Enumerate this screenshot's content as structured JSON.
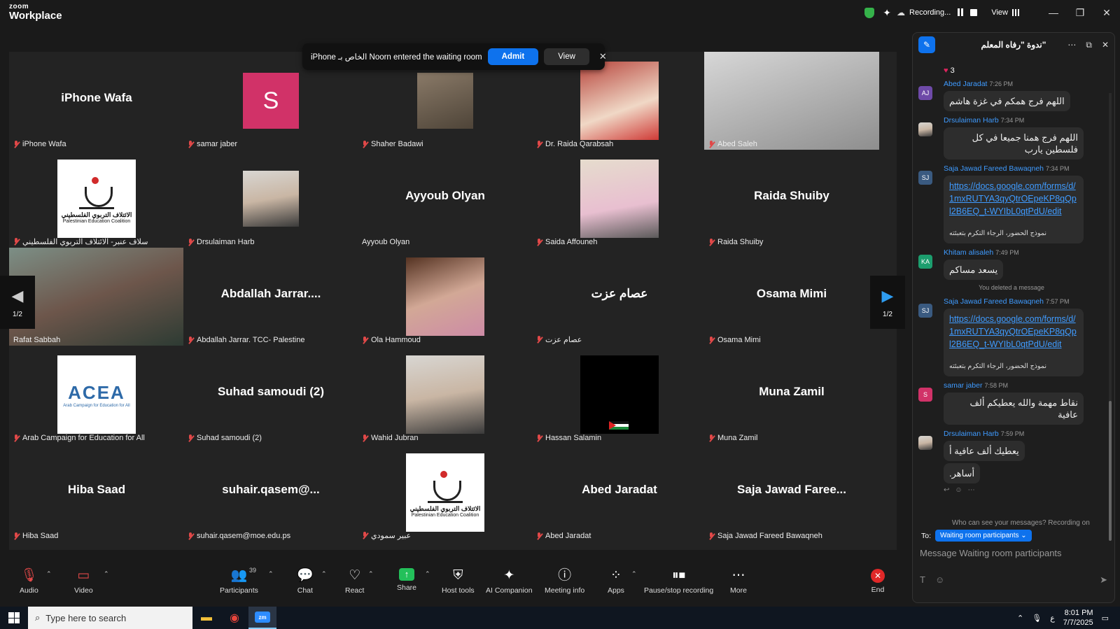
{
  "app": {
    "brand_top": "zoom",
    "brand_name": "Workplace",
    "recording_label": "Recording...",
    "view_label": "View"
  },
  "banner": {
    "text": "iPhone الخاص بـ Noorn entered the waiting room",
    "admit": "Admit",
    "view": "View"
  },
  "pager": {
    "left": "1/2",
    "right": "1/2"
  },
  "tiles": [
    {
      "big": "iPhone Wafa",
      "name": "iPhone Wafa"
    },
    {
      "avatar": "S",
      "name": "samar jaber"
    },
    {
      "name": "Shaher Badawi"
    },
    {
      "name": "Dr. Raida Qarabsah"
    },
    {
      "name": "Abed Saleh"
    },
    {
      "name": "سلاف عنبر- الائتلاف التربوي الفلسطيني",
      "logo_ar": "الائتلاف التربوي الفلسطيني",
      "logo_en": "Palestinian Education Coalition"
    },
    {
      "name": "Drsulaiman Harb"
    },
    {
      "big": "Ayyoub Olyan",
      "name": "Ayyoub Olyan"
    },
    {
      "name": "Saida Affouneh"
    },
    {
      "big": "Raida Shuiby",
      "name": "Raida Shuiby"
    },
    {
      "name": "Rafat Sabbah"
    },
    {
      "big": "Abdallah Jarrar....",
      "name": "Abdallah Jarrar. TCC- Palestine"
    },
    {
      "name": "Ola Hammoud"
    },
    {
      "big": "عصام عزت",
      "name": "عصام عزت"
    },
    {
      "big": "Osama Mimi",
      "name": "Osama Mimi"
    },
    {
      "name": "Arab Campaign for Education for All",
      "logo_big": "ACEA",
      "logo_sub": "Arab Campaign for Education for All"
    },
    {
      "big": "Suhad samoudi (2)",
      "name": "Suhad samoudi (2)"
    },
    {
      "name": "Wahid Jubran"
    },
    {
      "name": "Hassan Salamin"
    },
    {
      "big": "Muna Zamil",
      "name": "Muna Zamil"
    },
    {
      "big": "Hiba Saad",
      "name": "Hiba Saad"
    },
    {
      "big": "suhair.qasem@...",
      "name": "suhair.qasem@moe.edu.ps"
    },
    {
      "name": "عبير سمودي",
      "logo_ar": "الائتلاف التربوي الفلسطيني",
      "logo_en": "Palestinian Education Coalition"
    },
    {
      "big": "Abed Jaradat",
      "name": "Abed Jaradat"
    },
    {
      "big": "Saja Jawad Faree...",
      "name": "Saja Jawad Fareed Bawaqneh"
    }
  ],
  "chat": {
    "title": "ندوة \"رفاه المعلم\"",
    "reaction_count": "3",
    "messages": [
      {
        "avatar": "AJ",
        "author": "Abed Jaradat",
        "time": "7:26 PM",
        "text": "اللهم فرج همكم في غزة هاشم"
      },
      {
        "avatar": "",
        "author": "Drsulaiman Harb",
        "time": "7:34 PM",
        "text": "اللهم فرج همنا جميعا في كل فلسطين يارب"
      },
      {
        "avatar": "SJ",
        "author": "Saja Jawad Fareed Bawaqneh",
        "time": "7:34 PM",
        "link": "https://docs.google.com/forms/d/1mxRUTYA3qyQtrOEpeKP8qQpl2B6EQ_t-WYIbL0qtPdU/edit",
        "caption": "نموذج الحضور، الرجاء التكرم بتعبئته"
      },
      {
        "avatar": "KA",
        "author": "Khitam alisaleh",
        "time": "7:49 PM",
        "text": "يسعد مساكم"
      },
      {
        "avatar": "SJ",
        "author": "Saja Jawad Fareed Bawaqneh",
        "time": "7:57 PM",
        "link": "https://docs.google.com/forms/d/1mxRUTYA3qyQtrOEpeKP8qQpl2B6EQ_t-WYIbL0qtPdU/edit",
        "caption": "نموذج الحضور، الرجاء التكرم بتعبئته"
      },
      {
        "avatar": "S",
        "author": "samar jaber",
        "time": "7:58 PM",
        "text": "نقاط مهمة والله يعطيكم ألف عافية"
      },
      {
        "avatar": "",
        "author": "Drsulaiman Harb",
        "time": "7:59 PM",
        "text": "يعطيك ألف عافية أ",
        "text2": "أساهر."
      }
    ],
    "deleted": "You deleted a message",
    "who_can_see": "Who can see your messages? Recording on",
    "to_label": "To:",
    "to_value": "Waiting room participants",
    "input_placeholder": "Message Waiting room participants"
  },
  "toolbar": {
    "audio": "Audio",
    "video": "Video",
    "participants": "Participants",
    "participants_count": "39",
    "chat": "Chat",
    "react": "React",
    "share": "Share",
    "host_tools": "Host tools",
    "ai": "AI Companion",
    "meeting_info": "Meeting info",
    "apps": "Apps",
    "recording": "Pause/stop recording",
    "more": "More",
    "end": "End"
  },
  "taskbar": {
    "search": "Type here to search",
    "time": "8:01 PM",
    "date": "7/7/2025",
    "lang": "ع"
  },
  "colors": {
    "accent": "#0e72ed",
    "active_speaker": "#23d98c",
    "end": "#e02828"
  }
}
